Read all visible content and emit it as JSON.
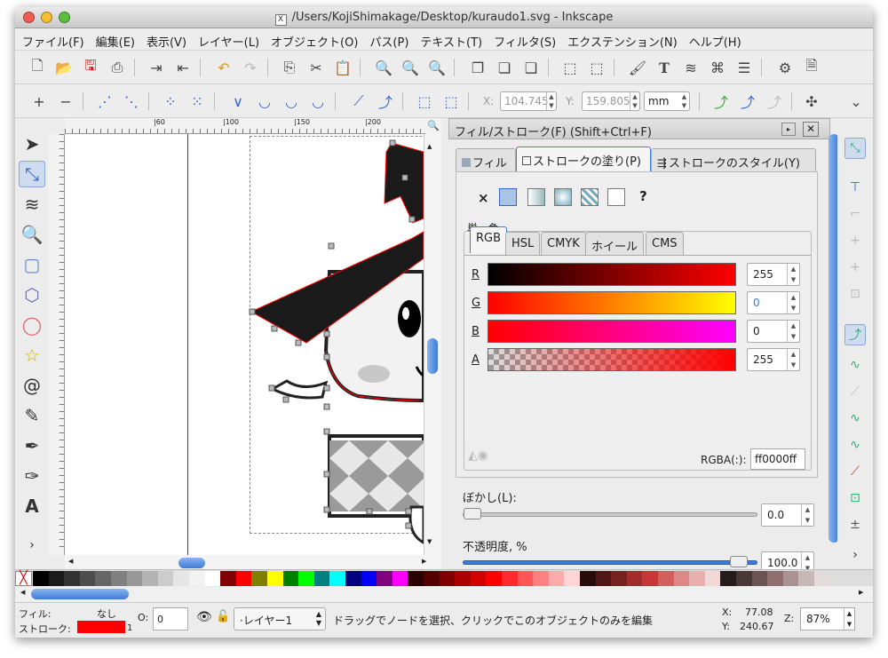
{
  "window": {
    "title": "/Users/KojiShimakage/Desktop/kuraudo1.svg - Inkscape",
    "file_icon": "X"
  },
  "menu": [
    "ファイル(F)",
    "編集(E)",
    "表示(V)",
    "レイヤー(L)",
    "オブジェクト(O)",
    "パス(P)",
    "テキスト(T)",
    "フィルタ(S)",
    "エクステンション(N)",
    "ヘルプ(H)"
  ],
  "toolbar2": {
    "x_label": "X:",
    "x_value": "104.745",
    "y_label": "Y:",
    "y_value": "159.805",
    "unit": "mm"
  },
  "ruler": {
    "h_ticks": [
      "|50",
      "|60",
      "|100",
      "|150",
      "|200"
    ],
    "v_ticks": [
      "7",
      "2",
      "5",
      "2",
      "5",
      "2",
      "0",
      "1",
      "7",
      "5",
      "1",
      "5"
    ]
  },
  "dialog": {
    "title": "フィル/ストローク(F) (Shift+Ctrl+F)",
    "tabs": [
      "フィル",
      "ストロークの塗り(P)",
      "ストロークのスタイル(Y)"
    ],
    "paint_none": "×",
    "paint_unset": "?",
    "flat_label": "単一色",
    "color_tabs": [
      "RGB",
      "HSL",
      "CMYK",
      "ホイール",
      "CMS"
    ],
    "channels": [
      {
        "label": "R",
        "value": "255"
      },
      {
        "label": "G",
        "value": "0"
      },
      {
        "label": "B",
        "value": "0"
      },
      {
        "label": "A",
        "value": "255"
      }
    ],
    "rgba_label": "RGBA(:):",
    "rgba_value": "ff0000ff",
    "blur_label": "ぼかし(L):",
    "blur_value": "0.0",
    "opacity_label": "不透明度, %",
    "opacity_value": "100.0"
  },
  "status": {
    "fill_label": "フィル:",
    "fill_value": "なし",
    "stroke_label": "ストローク:",
    "stroke_width": "1",
    "opacity_label": "O:",
    "opacity_value": "0",
    "layer": "·レイヤー1",
    "message": "ドラッグでノードを選択、クリックでこのオブジェクトのみを編集",
    "x_label": "X:",
    "x_value": "77.08",
    "y_label": "Y:",
    "y_value": "240.67",
    "zoom_label": "Z:",
    "zoom_value": "87%"
  },
  "colors": {
    "stroke": "#ff0000",
    "accent": "#3d7bd9"
  },
  "palette": [
    "#000000",
    "#1a1a1a",
    "#333333",
    "#4d4d4d",
    "#666666",
    "#808080",
    "#999999",
    "#b3b3b3",
    "#cccccc",
    "#e6e6e6",
    "#f2f2f2",
    "#ffffff",
    "#800000",
    "#ff0000",
    "#808000",
    "#ffff00",
    "#008000",
    "#00ff00",
    "#008080",
    "#00ffff",
    "#000080",
    "#0000ff",
    "#800080",
    "#ff00ff",
    "#2b0000",
    "#550000",
    "#800000",
    "#aa0000",
    "#d40000",
    "#ff0000",
    "#ff2a2a",
    "#ff5555",
    "#ff8080",
    "#ffaaaa",
    "#ffd5d5",
    "#280b0b",
    "#501616",
    "#782121",
    "#a02c2c",
    "#c83737",
    "#d35f5f",
    "#de8787",
    "#e9afaf",
    "#f4d7d7",
    "#241c1c",
    "#483737",
    "#6c5353",
    "#916f6f",
    "#ac9393",
    "#c8b7b7",
    "#e3dbdb"
  ]
}
